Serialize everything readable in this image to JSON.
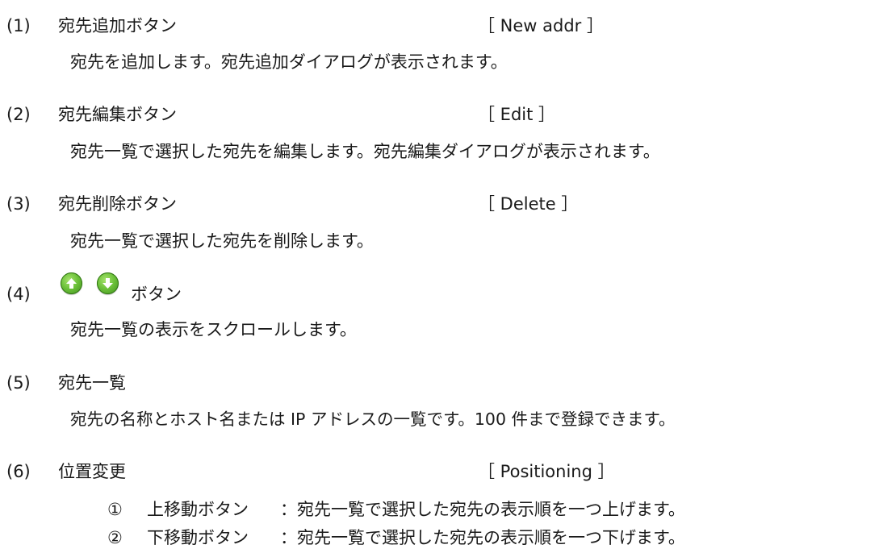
{
  "items": [
    {
      "num": "(1)",
      "title": "宛先追加ボタン",
      "tag": "［ New addr ］",
      "desc": "宛先を追加します。宛先追加ダイアログが表示されます。"
    },
    {
      "num": "(2)",
      "title": "宛先編集ボタン",
      "tag": "［ Edit ］",
      "desc": "宛先一覧で選択した宛先を編集します。宛先編集ダイアログが表示されます。"
    },
    {
      "num": "(3)",
      "title": "宛先削除ボタン",
      "tag": "［ Delete ］",
      "desc": "宛先一覧で選択した宛先を削除します。"
    },
    {
      "num": "(4)",
      "title": "ボタン",
      "desc": "宛先一覧の表示をスクロールします。"
    },
    {
      "num": "(5)",
      "title": "宛先一覧",
      "desc": "宛先の名称とホスト名または IP アドレスの一覧です。100 件まで登録できます。"
    },
    {
      "num": "(6)",
      "title": "位置変更",
      "tag": "［ Positioning ］",
      "subitems": [
        {
          "mark": "①",
          "label": "上移動ボタン",
          "colon": "：",
          "text": "宛先一覧で選択した宛先の表示順を一つ上げます。"
        },
        {
          "mark": "②",
          "label": "下移動ボタン",
          "colon": "：",
          "text": "宛先一覧で選択した宛先の表示順を一つ下げます。"
        }
      ]
    }
  ],
  "icons": {
    "up": "up-arrow-circle-icon",
    "down": "down-arrow-circle-icon",
    "color": "#5cb82e"
  }
}
